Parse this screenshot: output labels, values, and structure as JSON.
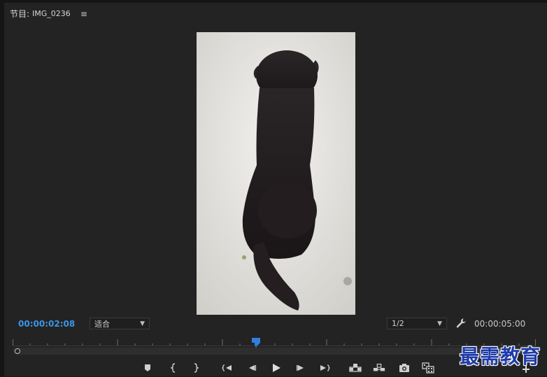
{
  "panel": {
    "tab_prefix": "节目:",
    "tab_name": "IMG_0236",
    "menu_icon": "hamburger-menu-icon"
  },
  "viewer": {
    "content": "photo-black-dog-sitting"
  },
  "status": {
    "current_timecode": "00:00:02:08",
    "fit_value": "适合",
    "resolution_value": "1/2",
    "duration_timecode": "00:00:05:00"
  },
  "colors": {
    "timecode_accent": "#3b95e6",
    "playhead": "#2f7fe0",
    "panel_bg": "#232323"
  },
  "controls": [
    "add-marker-icon",
    "mark-in-icon",
    "mark-out-icon",
    "go-to-in-icon",
    "step-back-icon",
    "play-icon",
    "step-forward-icon",
    "go-to-out-icon",
    "lift-icon",
    "extract-icon",
    "export-frame-icon",
    "comparison-view-icon"
  ],
  "watermark": {
    "text": "最需教育"
  }
}
